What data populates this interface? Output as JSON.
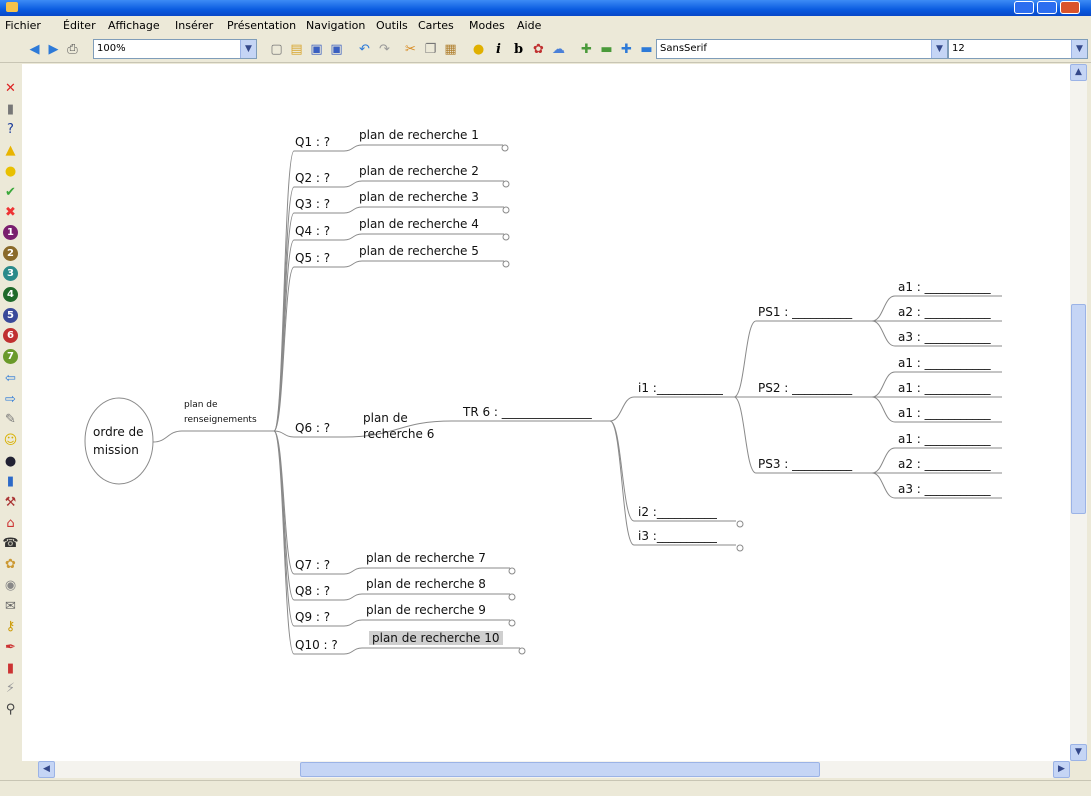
{
  "menu": [
    "Fichier",
    "Éditer",
    "Affichage",
    "Insérer",
    "Présentation",
    "Navigation",
    "Outils",
    "Cartes",
    "Modes",
    "Aide"
  ],
  "toolbar": {
    "zoom": "100%",
    "font_family": "SansSerif",
    "font_size": "12"
  },
  "side_icons": [
    "close-icon",
    "trash-icon",
    "question-icon",
    "warning-icon",
    "lightbulb-icon",
    "checkmark-icon",
    "cross-icon",
    "priority-1-icon",
    "priority-2-icon",
    "priority-3-icon",
    "priority-4-icon",
    "priority-5-icon",
    "priority-6-icon",
    "priority-7-icon",
    "arrow-left-icon",
    "arrow-right-icon",
    "pencil-icon",
    "smiley-icon",
    "bomb-icon",
    "book-icon",
    "hammer-icon",
    "home-icon",
    "phone-icon",
    "flower-icon",
    "disc-icon",
    "mail-icon",
    "key-icon",
    "pen-icon",
    "traffic-light-icon",
    "magic-wand-icon",
    "magnifier-icon"
  ],
  "map": {
    "root": [
      "ordre de",
      "mission"
    ],
    "root_branch": [
      "plan de",
      "renseignements"
    ],
    "questions": [
      {
        "q": "Q1 :  ?",
        "plan": "plan de recherche 1"
      },
      {
        "q": "Q2 :  ?",
        "plan": "plan de recherche 2"
      },
      {
        "q": "Q3 :  ?",
        "plan": "plan de recherche 3"
      },
      {
        "q": "Q4 :  ?",
        "plan": "plan de recherche 4"
      },
      {
        "q": "Q5 :  ?",
        "plan": "plan de recherche 5"
      },
      {
        "q": "Q6 :  ?",
        "plan": "plan de\nrecherche 6"
      },
      {
        "q": "Q7 :  ?",
        "plan": "plan de recherche 7"
      },
      {
        "q": "Q8 :  ?",
        "plan": "plan de recherche 8"
      },
      {
        "q": "Q9 :  ?",
        "plan": "plan de recherche 9"
      },
      {
        "q": "Q10 :  ?",
        "plan": "plan de recherche 10"
      }
    ],
    "tr": "TR 6 : _______________",
    "indices": [
      "i1 :___________",
      "i2 :__________",
      "i3 :__________"
    ],
    "ps": [
      "PS1 : __________",
      "PS2 : __________",
      "PS3 : __________"
    ],
    "attrs": [
      [
        "a1 : ___________",
        "a2 : ___________",
        "a3 : ___________"
      ],
      [
        "a1 : ___________",
        "a1 : ___________",
        "a1 : ___________"
      ],
      [
        "a1 : ___________",
        "a2 : ___________",
        "a3 : ___________"
      ]
    ]
  }
}
